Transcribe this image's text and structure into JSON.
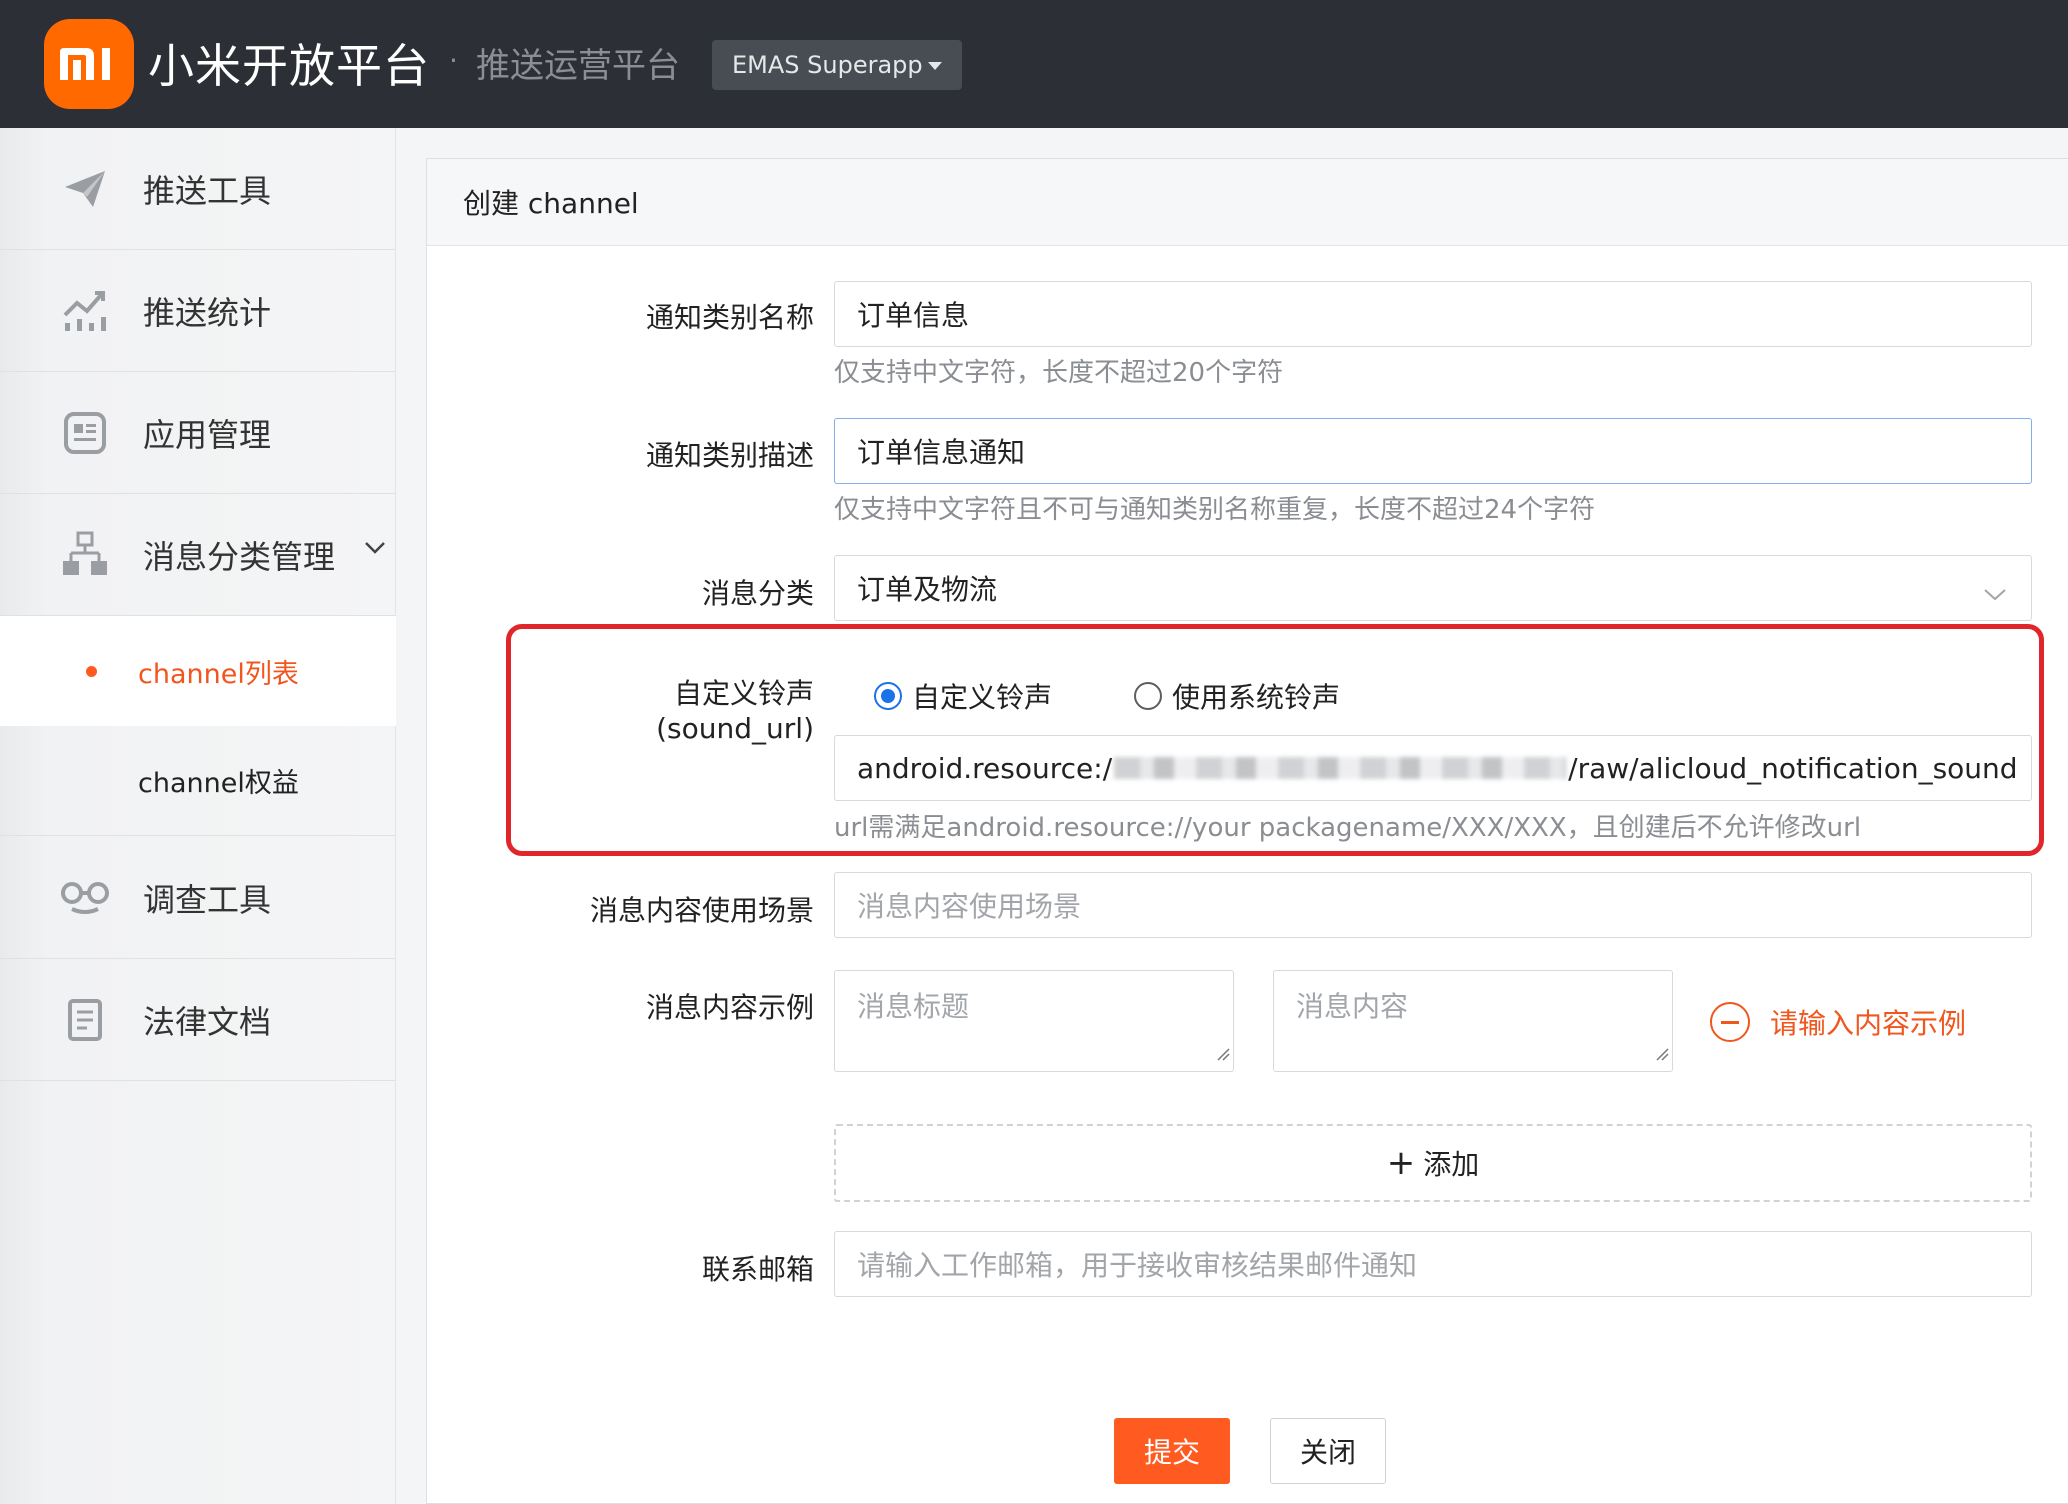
{
  "header": {
    "brand": "小米开放平台",
    "separator": "·",
    "subtitle": "推送运营平台",
    "app_selector": "EMAS Superapp",
    "logo_icon": "mi-logo-icon",
    "accent_color": "#ff6900"
  },
  "sidebar": {
    "items": [
      {
        "label": "推送工具",
        "icon": "paper-plane-icon"
      },
      {
        "label": "推送统计",
        "icon": "chart-line-icon"
      },
      {
        "label": "应用管理",
        "icon": "app-card-icon"
      },
      {
        "label": "消息分类管理",
        "icon": "hierarchy-icon"
      },
      {
        "label": "调查工具",
        "icon": "glasses-icon"
      },
      {
        "label": "法律文档",
        "icon": "document-icon"
      }
    ],
    "sub_items": [
      {
        "label": "channel列表",
        "active": true
      },
      {
        "label": "channel权益",
        "active": false
      }
    ]
  },
  "form": {
    "title": "创建 channel",
    "name": {
      "label": "通知类别名称",
      "value": "订单信息",
      "hint": "仅支持中文字符，长度不超过20个字符"
    },
    "description": {
      "label": "通知类别描述",
      "value": "订单信息通知",
      "hint": "仅支持中文字符且不可与通知类别名称重复，长度不超过24个字符"
    },
    "category": {
      "label": "消息分类",
      "value": "订单及物流"
    },
    "sound": {
      "label": "自定义铃声 (sound_url)",
      "option_custom": "自定义铃声",
      "option_system": "使用系统铃声",
      "selected": "自定义铃声",
      "url_prefix": "android.resource:/",
      "url_suffix": "/raw/alicloud_notification_sound",
      "hint": "url需满足android.resource://your packagename/XXX/XXX，且创建后不允许修改url"
    },
    "scenario": {
      "label": "消息内容使用场景",
      "placeholder": "消息内容使用场景"
    },
    "example": {
      "label": "消息内容示例",
      "title_placeholder": "消息标题",
      "content_placeholder": "消息内容",
      "remove_label": "请输入内容示例",
      "add_label": "添加"
    },
    "email": {
      "label": "联系邮箱",
      "placeholder": "请输入工作邮箱，用于接收审核结果邮件通知"
    },
    "submit_label": "提交",
    "close_label": "关闭"
  }
}
